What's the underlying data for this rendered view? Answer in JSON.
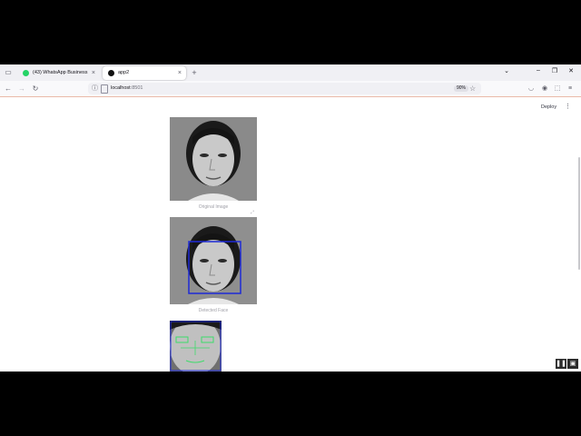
{
  "browser": {
    "tabs": [
      {
        "label": "(43) WhatsApp Business",
        "favicon_color": "#25d366"
      },
      {
        "label": "app2",
        "favicon_color": "#111111"
      }
    ],
    "new_tab": "+",
    "url_host": "localhost",
    "url_port": ":8501",
    "zoom": "90%"
  },
  "app": {
    "deploy_label": "Deploy",
    "images": [
      {
        "caption": "Original Image"
      },
      {
        "caption": "Detected Face",
        "box_color": "#1e2ad6"
      },
      {
        "caption": "",
        "landmark_color": "#3ddc6a"
      }
    ]
  }
}
